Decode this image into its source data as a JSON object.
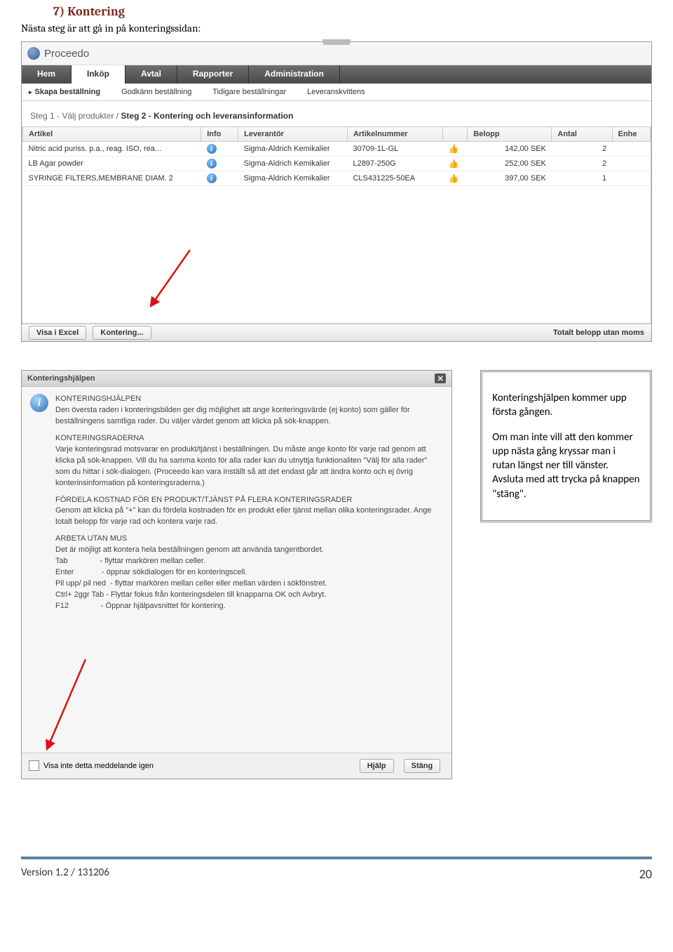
{
  "section": {
    "num": "7)",
    "title": "Kontering"
  },
  "intro": "Nästa steg är att gå in på konteringssidan:",
  "app": {
    "name": "Proceedo"
  },
  "mainMenu": [
    "Hem",
    "Inköp",
    "Avtal",
    "Rapporter",
    "Administration"
  ],
  "subMenu": [
    "Skapa beställning",
    "Godkänn beställning",
    "Tidigare beställningar",
    "Leveranskvittens"
  ],
  "step": {
    "prefix": "Steg 1 - Välj produkter / ",
    "active": "Steg 2 - Kontering och leveransinformation"
  },
  "headers": [
    "Artikel",
    "Info",
    "Leverantör",
    "Artikelnummer",
    "",
    "Belopp",
    "Antal",
    "Enhe"
  ],
  "rows": [
    {
      "artikel": "Nitric acid puriss. p.a., reag. ISO, rea...",
      "lev": "Sigma-Aldrich Kemikalier",
      "artnr": "30709-1L-GL",
      "belopp": "142,00 SEK",
      "antal": "2"
    },
    {
      "artikel": "LB Agar powder",
      "lev": "Sigma-Aldrich Kemikalier",
      "artnr": "L2897-250G",
      "belopp": "252,00 SEK",
      "antal": "2"
    },
    {
      "artikel": "SYRINGE FILTERS,MEMBRANE DIAM. 2",
      "lev": "Sigma-Aldrich Kemikalier",
      "artnr": "CLS431225-50EA",
      "belopp": "397,00 SEK",
      "antal": "1"
    }
  ],
  "bottom": {
    "visaExcel": "Visa i Excel",
    "kontering": "Kontering...",
    "total": "Totalt belopp utan moms"
  },
  "dialog": {
    "title": "Konteringshjälpen",
    "h1": "KONTERINGSHJÄLPEN",
    "p1": "Den översta raden i konteringsbilden ger dig möjlighet att ange konteringsvärde (ej konto) som gäller för beställningens samtliga rader. Du väljer värdet genom att klicka på sök-knappen.",
    "h2": "KONTERINGSRADERNA",
    "p2": "Varje konteringsrad motsvarar en produkt/tjänst i beställningen. Du måste ange konto för varje rad genom att klicka på sök-knappen. Vill du ha samma konto för alla rader kan du utnyttja funktionaliten \"Välj för alla rader\" som du hittar i sök-dialogen. (Proceedo kan vara inställt så att det endast går att ändra konto och ej övrig konterinsinformation på konteringsraderna.)",
    "h3": "FÖRDELA KOSTNAD FÖR EN PRODUKT/TJÄNST PÅ FLERA KONTERINGSRADER",
    "p3": "Genom att klicka på \"+\" kan du fördela kostnaden för en produkt eller tjänst mellan olika konteringsrader. Ange totalt belopp för varje rad och kontera varje rad.",
    "h4": "ARBETA UTAN MUS",
    "p4": "Det är möjligt att kontera hela beställningen genom att använda tangentbordet.",
    "kb": [
      "Tab               - flyttar markören mellan celler.",
      "Enter             - öppnar sökdialogen för en konteringscell.",
      "Pil upp/ pil ned  - flyttar markören mellan celler eller mellan värden i sökfönstret.",
      "Ctrl+ 2ggr Tab - Flyttar fokus från konteringsdelen till knapparna OK och Avbryt.",
      "F12               - Öppnar hjälpavsnittet för kontering."
    ],
    "checkbox": "Visa inte detta meddelande igen",
    "hjalpBtn": "Hjälp",
    "stangBtn": "Stäng"
  },
  "callout": {
    "p1": "Konteringshjälpen kommer upp första gången.",
    "p2": "Om man inte vill att den kommer upp nästa gång kryssar man i rutan längst ner till vänster. Avsluta med att trycka på knappen \"stäng\"."
  },
  "footer": {
    "version": "Version 1.2 / 131206",
    "page": "20"
  }
}
